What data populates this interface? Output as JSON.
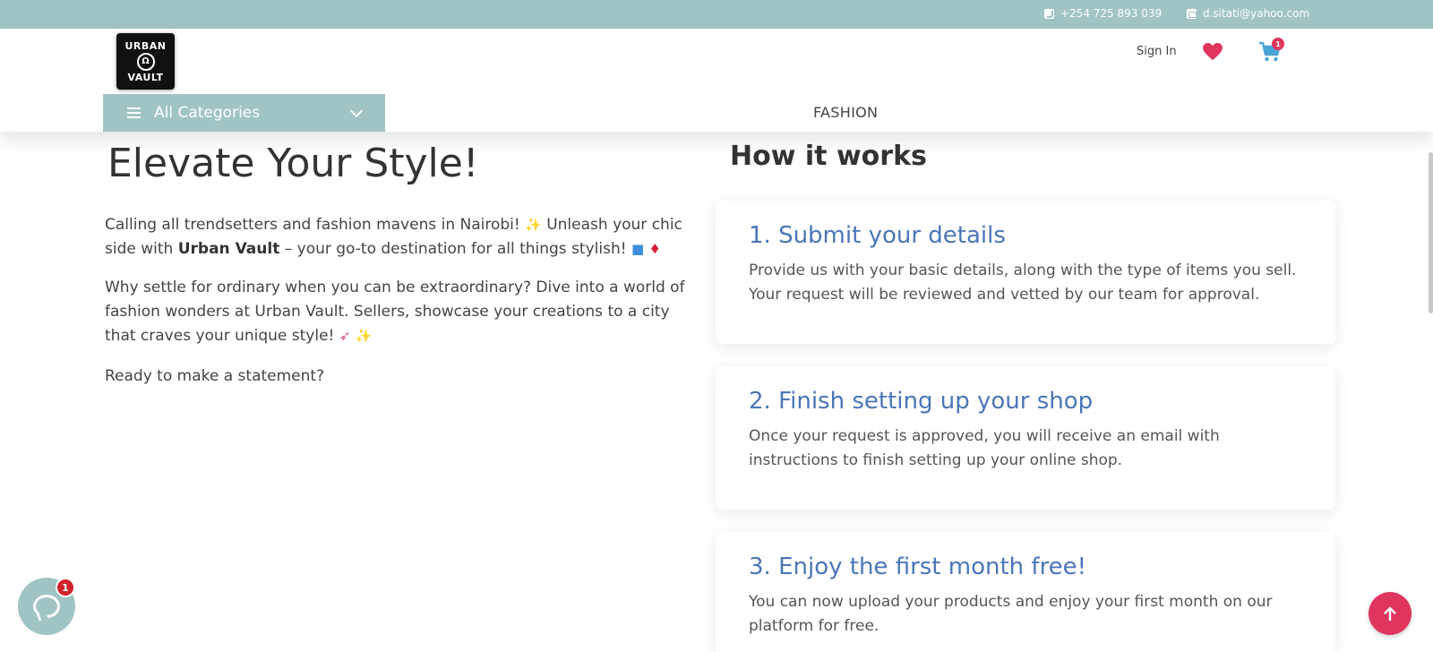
{
  "topbar": {
    "phone": "+254 725 893 039",
    "email": "d.sitati@yahoo.com"
  },
  "header": {
    "logo_line1": "URBAN",
    "logo_line2": "VAULT",
    "sign_in": "Sign In",
    "cart_count": "1",
    "categories_label": "All Categories",
    "nav_fashion": "FASHION"
  },
  "hero": {
    "title": "Elevate Your Style!",
    "p1_a": "Calling all trendsetters and fashion mavens in Nairobi!",
    "p1_b": "Unleash your chic side with",
    "p1_brand": "Urban Vault",
    "p1_c": "– your go-to destination for all things stylish!",
    "p2": "Why settle for ordinary when you can be extraordinary? Dive into a world of fashion wonders at Urban Vault. Sellers, showcase your creations to a city that craves your unique style!",
    "p3": "Ready to make a statement?"
  },
  "how": {
    "title": "How it works",
    "steps": [
      {
        "title": "1. Submit your details",
        "desc": "Provide us with your basic details, along with the type of items you sell. Your request will be reviewed and vetted by our team for approval."
      },
      {
        "title": "2. Finish setting up your shop",
        "desc": "Once your request is approved, you will receive an email with instructions to finish setting up your online shop."
      },
      {
        "title": "3. Enjoy the first month free!",
        "desc": "You can now upload your products and enjoy your first month on our platform for free."
      }
    ]
  },
  "chat": {
    "badge": "1"
  },
  "colors": {
    "accent": "#a0c4c4",
    "link_blue": "#4a76b8",
    "pink": "#e0365e"
  }
}
